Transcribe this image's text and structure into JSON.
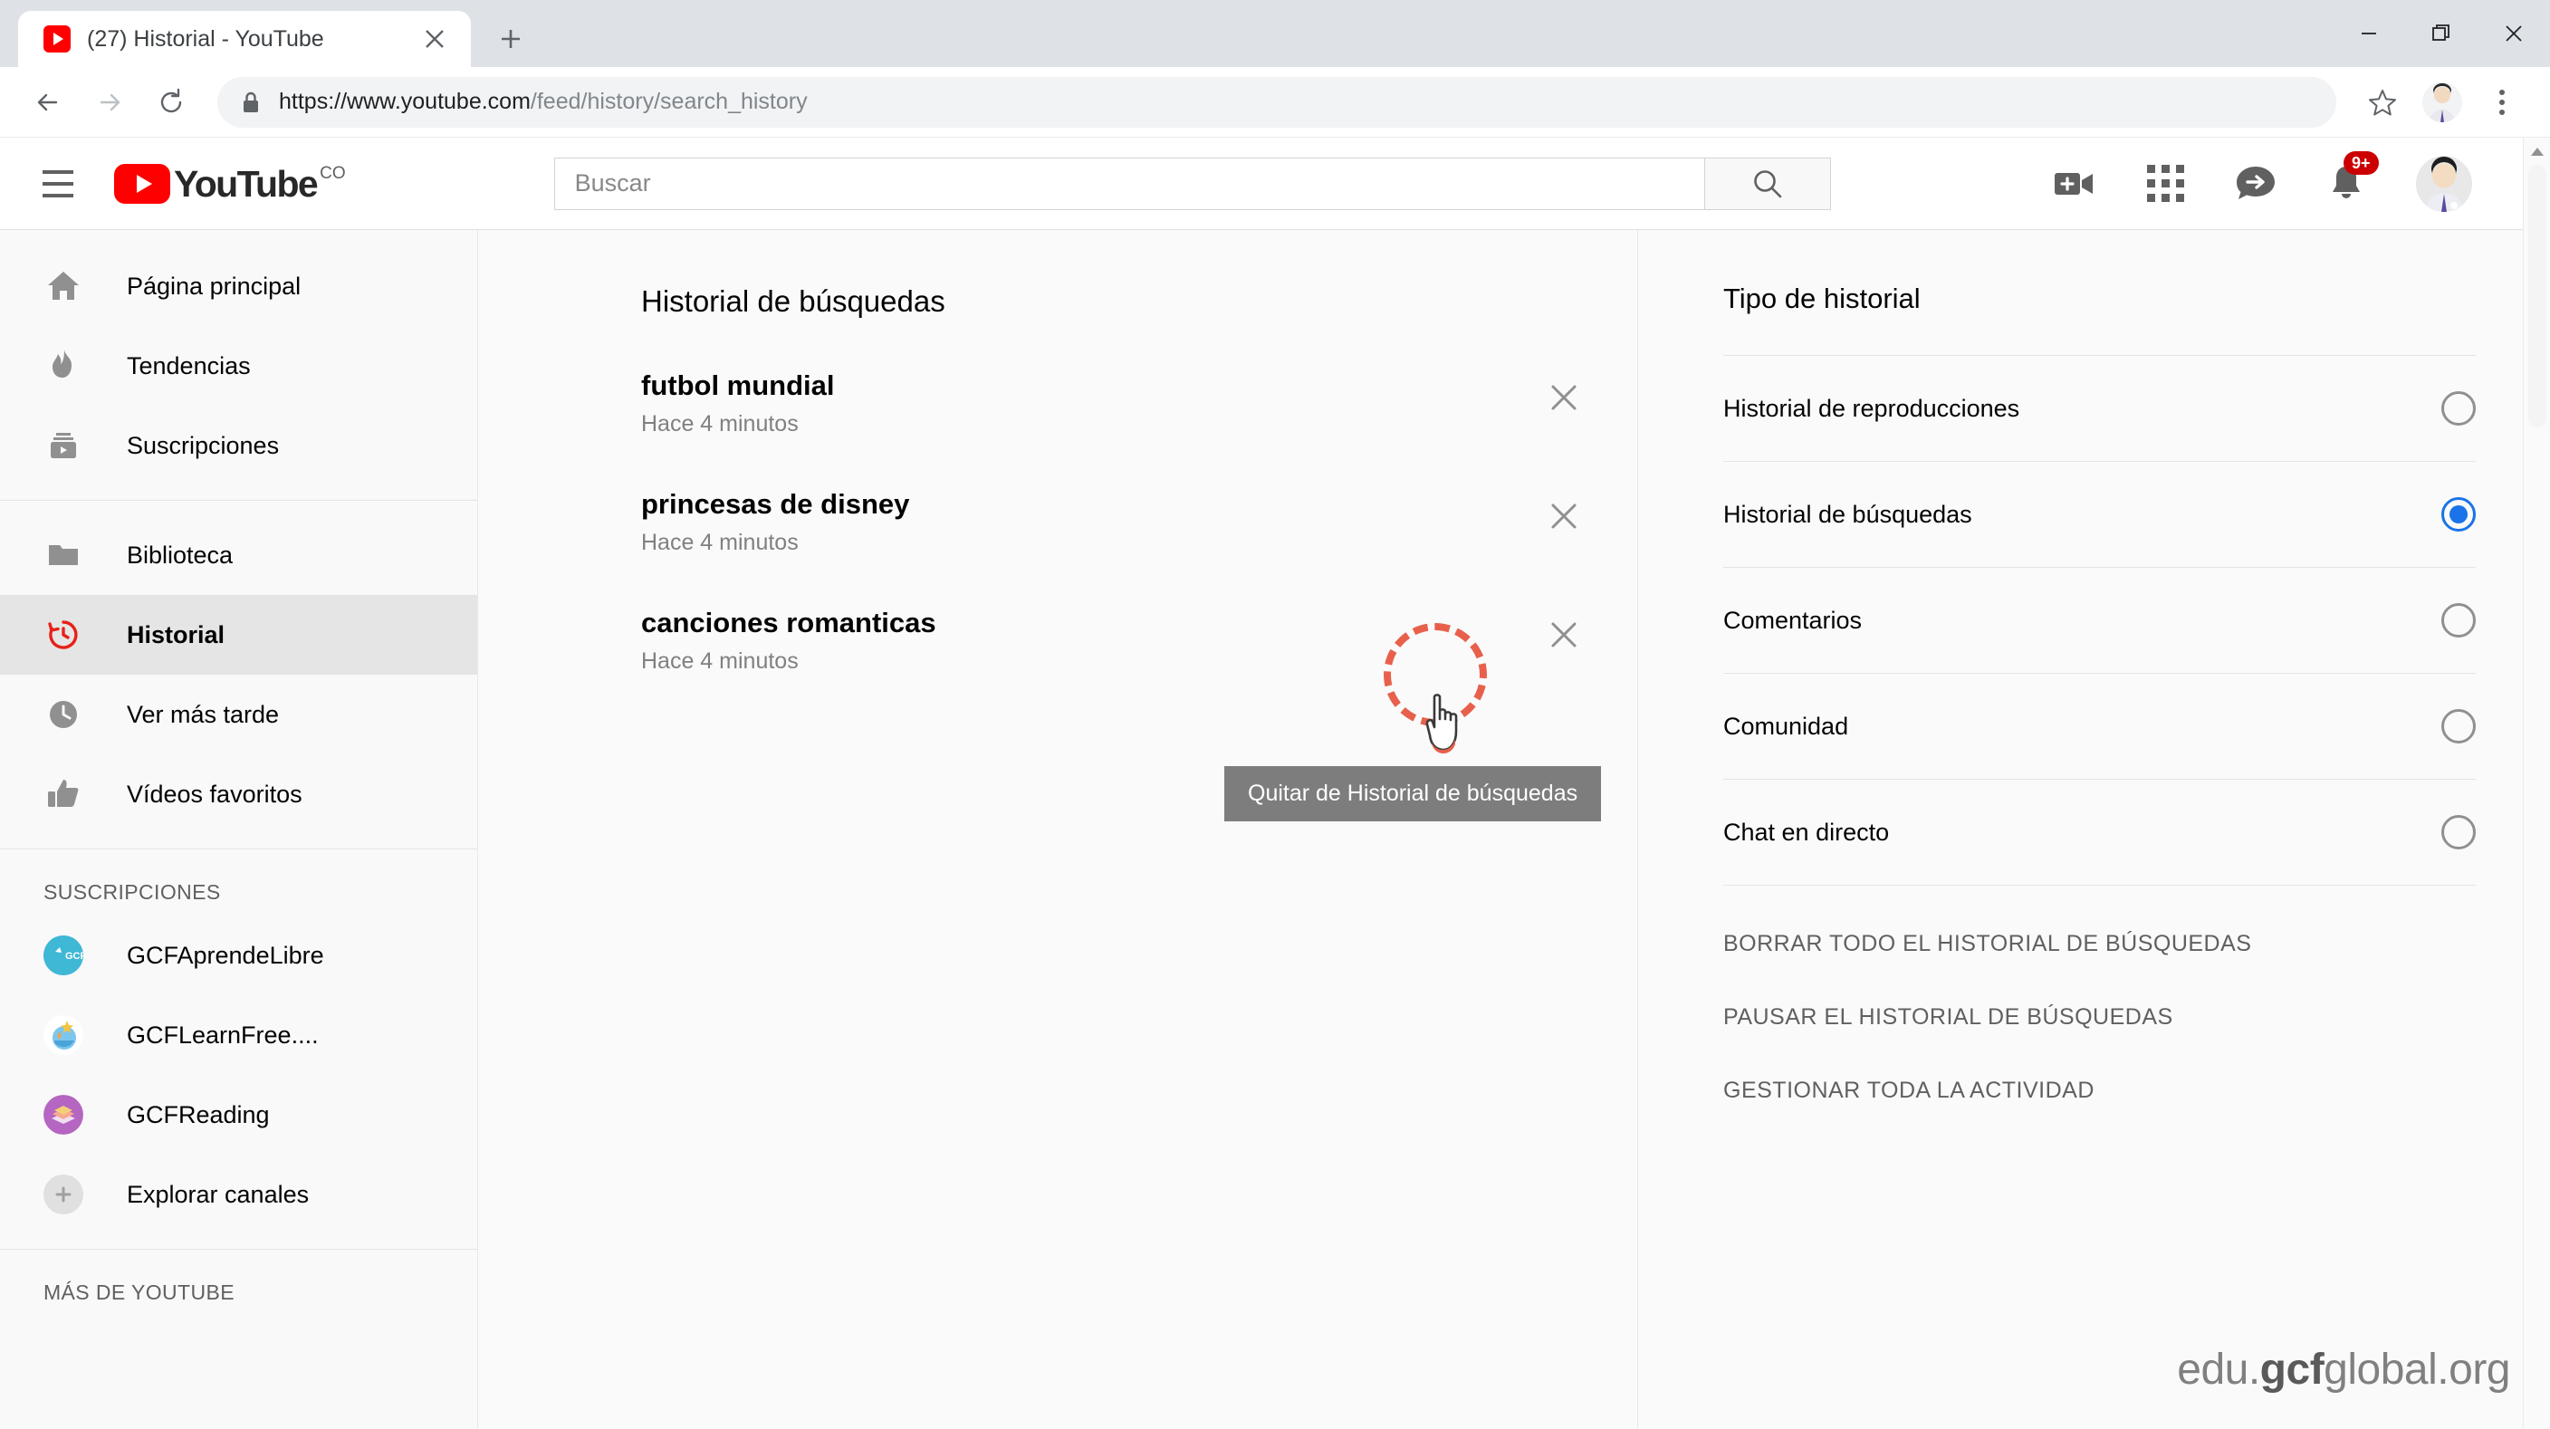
{
  "browser": {
    "tab": {
      "title": "(27) Historial - YouTube",
      "favicon_icon": "youtube-favicon",
      "close_icon": "close-icon"
    },
    "new_tab_icon": "plus-icon",
    "window_controls": {
      "minimize_icon": "minimize-icon",
      "restore_icon": "restore-icon",
      "close_icon": "close-icon"
    },
    "nav": {
      "back_icon": "arrow-left-icon",
      "forward_icon": "arrow-right-icon",
      "reload_icon": "reload-icon"
    },
    "omnibox": {
      "lock_icon": "lock-icon",
      "url_prefix": "https://www.youtube.com",
      "url_path": "/feed/history/search_history"
    },
    "bookmark_icon": "star-icon",
    "profile_icon": "profile-avatar",
    "menu_icon": "kebab-menu-icon"
  },
  "masthead": {
    "menu_icon": "hamburger-icon",
    "logo": {
      "name": "youtube-logo",
      "word": "YouTube",
      "country_code": "CO"
    },
    "search": {
      "placeholder": "Buscar",
      "value": "",
      "button_icon": "search-icon"
    },
    "icons": [
      {
        "name": "video-upload-icon",
        "label": ""
      },
      {
        "name": "apps-grid-icon",
        "label": ""
      },
      {
        "name": "message-share-icon",
        "label": ""
      },
      {
        "name": "notifications-bell-icon",
        "label": "",
        "badge": "9+"
      },
      {
        "name": "account-avatar",
        "label": ""
      }
    ]
  },
  "sidebar": {
    "primary": [
      {
        "label": "Página principal",
        "icon": "home-icon",
        "active": false
      },
      {
        "label": "Tendencias",
        "icon": "trending-flame-icon",
        "active": false
      },
      {
        "label": "Suscripciones",
        "icon": "subscriptions-icon",
        "active": false
      }
    ],
    "library": [
      {
        "label": "Biblioteca",
        "icon": "library-folder-icon",
        "active": false
      },
      {
        "label": "Historial",
        "icon": "history-clock-icon",
        "active": true
      },
      {
        "label": "Ver más tarde",
        "icon": "watch-later-clock-icon",
        "active": false
      },
      {
        "label": "Vídeos favoritos",
        "icon": "thumbs-up-icon",
        "active": false
      }
    ],
    "subs_heading": "SUSCRIPCIONES",
    "subscriptions": [
      {
        "label": "GCFAprendeLibre",
        "avatar": "gcf-aprendelibre-avatar",
        "initials": "GCF",
        "color": "#3fb8d6",
        "new": false
      },
      {
        "label": "GCFLearnFree....",
        "avatar": "gcf-learnfree-avatar",
        "initials": "",
        "color": "#ffffff",
        "new": true
      },
      {
        "label": "GCFReading",
        "avatar": "gcf-reading-avatar",
        "initials": "",
        "color": "#b565c2",
        "new": false
      },
      {
        "label": "Explorar canales",
        "avatar": "explore-channels-icon",
        "initials": "+",
        "color": "#e0e0e0",
        "new": false
      }
    ],
    "more_heading": "MÁS DE YOUTUBE"
  },
  "main": {
    "title": "Historial de búsquedas",
    "remove_icon": "close-icon",
    "items": [
      {
        "query": "futbol mundial",
        "time": "Hace 4 minutos"
      },
      {
        "query": "princesas de disney",
        "time": "Hace 4 minutos"
      },
      {
        "query": "canciones romanticas",
        "time": "Hace 4 minutos"
      }
    ],
    "tooltip": "Quitar de Historial de búsquedas"
  },
  "right_panel": {
    "title": "Tipo de historial",
    "options": [
      {
        "label": "Historial de reproducciones",
        "selected": false
      },
      {
        "label": "Historial de búsquedas",
        "selected": true
      },
      {
        "label": "Comentarios",
        "selected": false
      },
      {
        "label": "Comunidad",
        "selected": false
      },
      {
        "label": "Chat en directo",
        "selected": false
      }
    ],
    "actions": [
      "BORRAR TODO EL HISTORIAL DE BÚSQUEDAS",
      "PAUSAR EL HISTORIAL DE BÚSQUEDAS",
      "GESTIONAR TODA LA ACTIVIDAD"
    ]
  },
  "watermark": {
    "prefix": "edu.",
    "bold": "gcf",
    "suffix": "global.org"
  },
  "colors": {
    "youtube_red": "#ff0000",
    "history_red": "#e62117",
    "radio_blue": "#1a73e8",
    "annotation_red": "#e8604c",
    "tooltip_bg": "#7d7d7d"
  }
}
